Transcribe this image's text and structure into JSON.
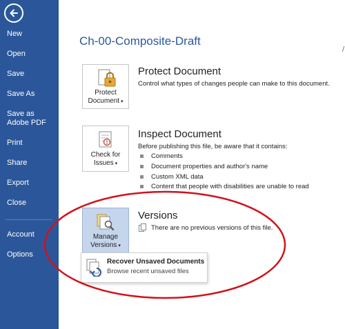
{
  "sidebar": {
    "items": [
      {
        "label": "New"
      },
      {
        "label": "Open"
      },
      {
        "label": "Save"
      },
      {
        "label": "Save As"
      },
      {
        "label": "Save as Adobe PDF"
      },
      {
        "label": "Print"
      },
      {
        "label": "Share"
      },
      {
        "label": "Export"
      },
      {
        "label": "Close"
      },
      {
        "label": "Account"
      },
      {
        "label": "Options"
      }
    ]
  },
  "document": {
    "title": "Ch-00-Composite-Draft"
  },
  "sections": {
    "protect": {
      "button_line1": "Protect",
      "button_line2": "Document",
      "title": "Protect Document",
      "description": "Control what types of changes people can make to this document."
    },
    "inspect": {
      "button_line1": "Check for",
      "button_line2": "Issues",
      "title": "Inspect Document",
      "description": "Before publishing this file, be aware that it contains:",
      "bullets": [
        "Comments",
        "Document properties and author's name",
        "Custom XML data",
        "Content that people with disabilities are unable to read"
      ]
    },
    "versions": {
      "button_line1": "Manage",
      "button_line2": "Versions",
      "title": "Versions",
      "description": "There are no previous versions of this file."
    }
  },
  "dropdown": {
    "title": "Recover Unsaved Documents",
    "subtitle": "Browse recent unsaved files"
  },
  "colors": {
    "sidebar": "#2b579a",
    "accent": "#2b579a",
    "annotation": "#d0121b",
    "active_button": "#c5d5ec"
  }
}
